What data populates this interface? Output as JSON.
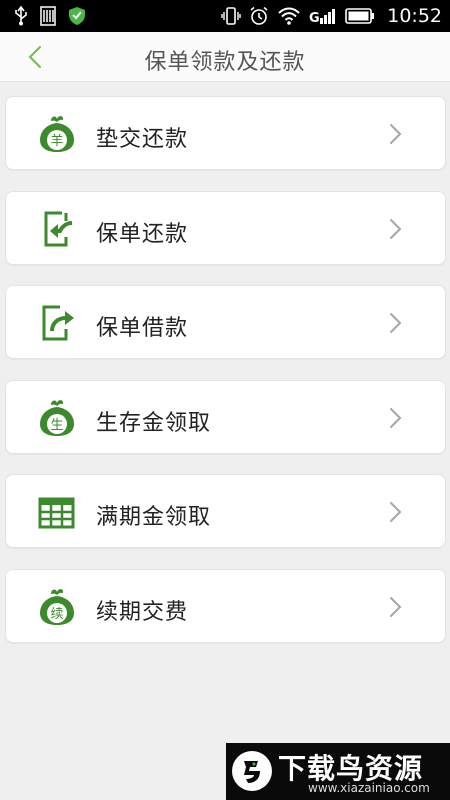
{
  "status_bar": {
    "time": "10:52",
    "icons": [
      "usb-icon",
      "sim-icon",
      "shield-icon",
      "vibrate-icon",
      "alarm-icon",
      "wifi-icon",
      "signal-icon",
      "battery-icon"
    ]
  },
  "header": {
    "title": "保单领款及还款",
    "back_icon": "chevron-left-icon"
  },
  "colors": {
    "accent": "#3d8a2e",
    "accent_light": "#6db33f",
    "back_arrow": "#6cc04a",
    "background": "#efefef"
  },
  "items": [
    {
      "label": "垫交还款",
      "icon": "money-bag-icon",
      "glyph": "羊"
    },
    {
      "label": "保单还款",
      "icon": "document-in-icon"
    },
    {
      "label": "保单借款",
      "icon": "document-out-icon"
    },
    {
      "label": "生存金领取",
      "icon": "money-bag-icon",
      "glyph": "生"
    },
    {
      "label": "满期金领取",
      "icon": "table-icon"
    },
    {
      "label": "续期交费",
      "icon": "money-bag-icon",
      "glyph": "续"
    }
  ],
  "watermark": {
    "title": "下载鸟资源",
    "url": "www.xiazainiao.com"
  }
}
